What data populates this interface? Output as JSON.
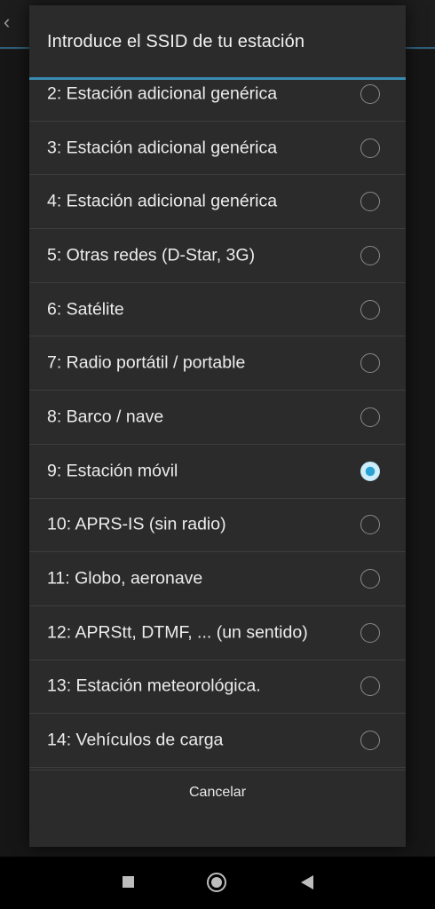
{
  "dialog": {
    "title": "Introduce el SSID de tu estación",
    "cancel_label": "Cancelar",
    "options": [
      {
        "label": "2: Estación adicional genérica",
        "selected": false
      },
      {
        "label": "3: Estación adicional genérica",
        "selected": false
      },
      {
        "label": "4: Estación adicional genérica",
        "selected": false
      },
      {
        "label": "5: Otras redes (D-Star, 3G)",
        "selected": false
      },
      {
        "label": "6: Satélite",
        "selected": false
      },
      {
        "label": "7: Radio portátil / portable",
        "selected": false
      },
      {
        "label": "8: Barco / nave",
        "selected": false
      },
      {
        "label": "9: Estación móvil",
        "selected": true
      },
      {
        "label": "10: APRS-IS (sin radio)",
        "selected": false
      },
      {
        "label": "11: Globo, aeronave",
        "selected": false
      },
      {
        "label": "12: APRStt, DTMF, ... (un sentido)",
        "selected": false
      },
      {
        "label": "13: Estación meteorológica.",
        "selected": false
      },
      {
        "label": "14: Vehículos de carga",
        "selected": false
      }
    ]
  },
  "colors": {
    "accent": "#3a8bb0",
    "radio_selected": "#2aa3d4"
  },
  "navbar": {
    "icons": [
      "recents-icon",
      "home-icon",
      "back-icon"
    ]
  }
}
